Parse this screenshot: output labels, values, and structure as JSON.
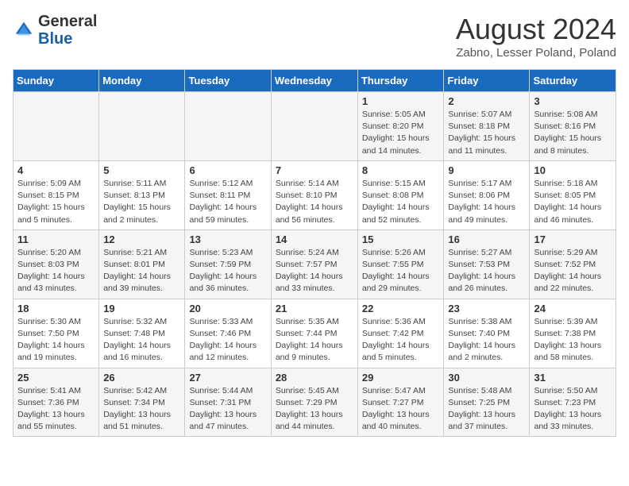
{
  "header": {
    "logo": {
      "general": "General",
      "blue": "Blue"
    },
    "title": "August 2024",
    "location": "Zabno, Lesser Poland, Poland"
  },
  "days_of_week": [
    "Sunday",
    "Monday",
    "Tuesday",
    "Wednesday",
    "Thursday",
    "Friday",
    "Saturday"
  ],
  "weeks": [
    [
      {
        "day": "",
        "info": ""
      },
      {
        "day": "",
        "info": ""
      },
      {
        "day": "",
        "info": ""
      },
      {
        "day": "",
        "info": ""
      },
      {
        "day": "1",
        "info": "Sunrise: 5:05 AM\nSunset: 8:20 PM\nDaylight: 15 hours\nand 14 minutes."
      },
      {
        "day": "2",
        "info": "Sunrise: 5:07 AM\nSunset: 8:18 PM\nDaylight: 15 hours\nand 11 minutes."
      },
      {
        "day": "3",
        "info": "Sunrise: 5:08 AM\nSunset: 8:16 PM\nDaylight: 15 hours\nand 8 minutes."
      }
    ],
    [
      {
        "day": "4",
        "info": "Sunrise: 5:09 AM\nSunset: 8:15 PM\nDaylight: 15 hours\nand 5 minutes."
      },
      {
        "day": "5",
        "info": "Sunrise: 5:11 AM\nSunset: 8:13 PM\nDaylight: 15 hours\nand 2 minutes."
      },
      {
        "day": "6",
        "info": "Sunrise: 5:12 AM\nSunset: 8:11 PM\nDaylight: 14 hours\nand 59 minutes."
      },
      {
        "day": "7",
        "info": "Sunrise: 5:14 AM\nSunset: 8:10 PM\nDaylight: 14 hours\nand 56 minutes."
      },
      {
        "day": "8",
        "info": "Sunrise: 5:15 AM\nSunset: 8:08 PM\nDaylight: 14 hours\nand 52 minutes."
      },
      {
        "day": "9",
        "info": "Sunrise: 5:17 AM\nSunset: 8:06 PM\nDaylight: 14 hours\nand 49 minutes."
      },
      {
        "day": "10",
        "info": "Sunrise: 5:18 AM\nSunset: 8:05 PM\nDaylight: 14 hours\nand 46 minutes."
      }
    ],
    [
      {
        "day": "11",
        "info": "Sunrise: 5:20 AM\nSunset: 8:03 PM\nDaylight: 14 hours\nand 43 minutes."
      },
      {
        "day": "12",
        "info": "Sunrise: 5:21 AM\nSunset: 8:01 PM\nDaylight: 14 hours\nand 39 minutes."
      },
      {
        "day": "13",
        "info": "Sunrise: 5:23 AM\nSunset: 7:59 PM\nDaylight: 14 hours\nand 36 minutes."
      },
      {
        "day": "14",
        "info": "Sunrise: 5:24 AM\nSunset: 7:57 PM\nDaylight: 14 hours\nand 33 minutes."
      },
      {
        "day": "15",
        "info": "Sunrise: 5:26 AM\nSunset: 7:55 PM\nDaylight: 14 hours\nand 29 minutes."
      },
      {
        "day": "16",
        "info": "Sunrise: 5:27 AM\nSunset: 7:53 PM\nDaylight: 14 hours\nand 26 minutes."
      },
      {
        "day": "17",
        "info": "Sunrise: 5:29 AM\nSunset: 7:52 PM\nDaylight: 14 hours\nand 22 minutes."
      }
    ],
    [
      {
        "day": "18",
        "info": "Sunrise: 5:30 AM\nSunset: 7:50 PM\nDaylight: 14 hours\nand 19 minutes."
      },
      {
        "day": "19",
        "info": "Sunrise: 5:32 AM\nSunset: 7:48 PM\nDaylight: 14 hours\nand 16 minutes."
      },
      {
        "day": "20",
        "info": "Sunrise: 5:33 AM\nSunset: 7:46 PM\nDaylight: 14 hours\nand 12 minutes."
      },
      {
        "day": "21",
        "info": "Sunrise: 5:35 AM\nSunset: 7:44 PM\nDaylight: 14 hours\nand 9 minutes."
      },
      {
        "day": "22",
        "info": "Sunrise: 5:36 AM\nSunset: 7:42 PM\nDaylight: 14 hours\nand 5 minutes."
      },
      {
        "day": "23",
        "info": "Sunrise: 5:38 AM\nSunset: 7:40 PM\nDaylight: 14 hours\nand 2 minutes."
      },
      {
        "day": "24",
        "info": "Sunrise: 5:39 AM\nSunset: 7:38 PM\nDaylight: 13 hours\nand 58 minutes."
      }
    ],
    [
      {
        "day": "25",
        "info": "Sunrise: 5:41 AM\nSunset: 7:36 PM\nDaylight: 13 hours\nand 55 minutes."
      },
      {
        "day": "26",
        "info": "Sunrise: 5:42 AM\nSunset: 7:34 PM\nDaylight: 13 hours\nand 51 minutes."
      },
      {
        "day": "27",
        "info": "Sunrise: 5:44 AM\nSunset: 7:31 PM\nDaylight: 13 hours\nand 47 minutes."
      },
      {
        "day": "28",
        "info": "Sunrise: 5:45 AM\nSunset: 7:29 PM\nDaylight: 13 hours\nand 44 minutes."
      },
      {
        "day": "29",
        "info": "Sunrise: 5:47 AM\nSunset: 7:27 PM\nDaylight: 13 hours\nand 40 minutes."
      },
      {
        "day": "30",
        "info": "Sunrise: 5:48 AM\nSunset: 7:25 PM\nDaylight: 13 hours\nand 37 minutes."
      },
      {
        "day": "31",
        "info": "Sunrise: 5:50 AM\nSunset: 7:23 PM\nDaylight: 13 hours\nand 33 minutes."
      }
    ]
  ]
}
